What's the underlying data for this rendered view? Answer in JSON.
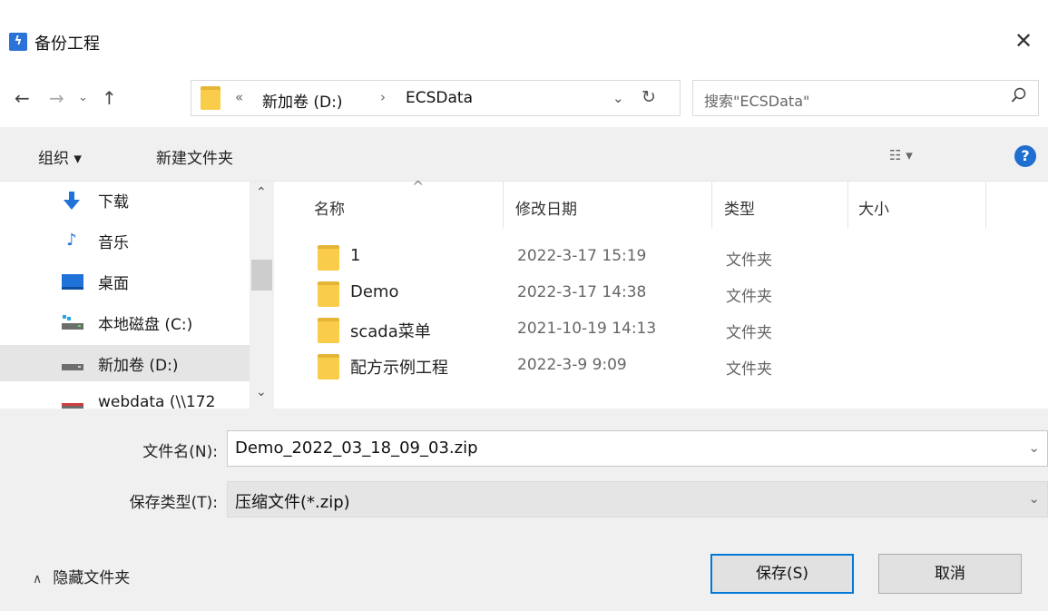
{
  "window": {
    "title": "备份工程",
    "app_icon": "app-icon",
    "close": "✕"
  },
  "address_bar": {
    "back": "←",
    "forward": "→",
    "recent": "⌄",
    "up": "↑",
    "overflow": "«",
    "breadcrumbs": [
      "新加卷 (D:)",
      "ECSData"
    ],
    "separator": "›",
    "dropdown": "⌄",
    "refresh": "↻",
    "search_placeholder": "搜索\"ECSData\"",
    "search_icon": "⚲"
  },
  "toolbar": {
    "organize": "组织 ▾",
    "new_folder": "新建文件夹",
    "view": "☷ ▾",
    "help": "?"
  },
  "nav_pane": {
    "items": [
      {
        "label": "下载",
        "icon": "download-icon"
      },
      {
        "label": "音乐",
        "icon": "music-icon"
      },
      {
        "label": "桌面",
        "icon": "desktop-icon"
      },
      {
        "label": "本地磁盘 (C:)",
        "icon": "drive-icon"
      },
      {
        "label": "新加卷 (D:)",
        "icon": "drive-icon",
        "selected": true
      },
      {
        "label": "webdata (\\\\172",
        "icon": "network-drive-icon"
      }
    ]
  },
  "file_list": {
    "columns": [
      "名称",
      "修改日期",
      "类型",
      "大小"
    ],
    "rows": [
      {
        "name": "1",
        "date": "2022-3-17 15:19",
        "type": "文件夹"
      },
      {
        "name": "Demo",
        "date": "2022-3-17 14:38",
        "type": "文件夹"
      },
      {
        "name": "scada菜单",
        "date": "2021-10-19 14:13",
        "type": "文件夹"
      },
      {
        "name": "配方示例工程",
        "date": "2022-3-9 9:09",
        "type": "文件夹"
      }
    ]
  },
  "form": {
    "filename_label": "文件名(N):",
    "filename_value": "Demo_2022_03_18_09_03.zip",
    "filetype_label": "保存类型(T):",
    "filetype_value": "压缩文件(*.zip)"
  },
  "footer": {
    "hide_folders": "隐藏文件夹",
    "save": "保存(S)",
    "cancel": "取消"
  },
  "colors": {
    "accent": "#0078d7",
    "folder": "#f9cd4a",
    "selection": "#e5e5e5"
  }
}
